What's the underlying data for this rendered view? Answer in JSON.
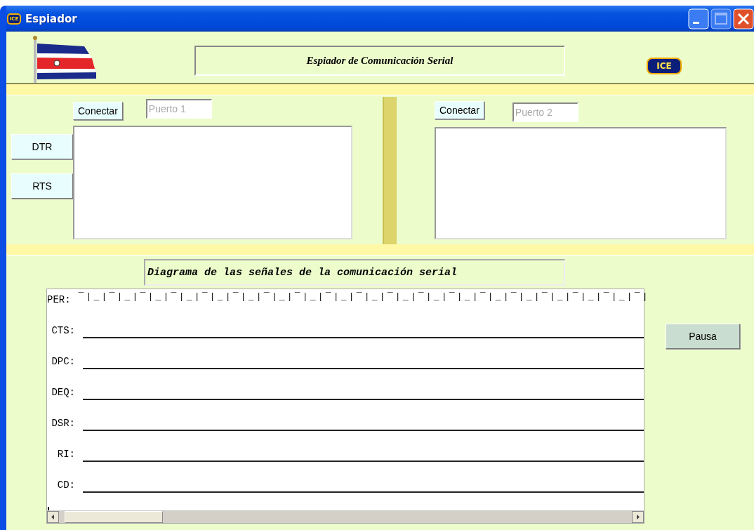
{
  "window": {
    "title": "Espiador",
    "icon_text": "ICE"
  },
  "header": {
    "title": "Espiador de Comunicación Serial",
    "logo_text": "ICE"
  },
  "ports": [
    {
      "connect_label": "Conectar",
      "port_placeholder": "Puerto 1"
    },
    {
      "connect_label": "Conectar",
      "port_placeholder": "Puerto 2"
    }
  ],
  "line_buttons": [
    "DTR",
    "RTS"
  ],
  "diagram": {
    "title": "Diagrama de las señales de la comunicación serial",
    "signals": [
      {
        "name": "PER:",
        "kind": "pulse",
        "trace": "¯|_|¯|_|¯|_|¯|_|¯|_|¯|_|¯|_|¯|_|¯|_|¯|_|¯|_|¯|_|¯|_|¯|_|¯|_|¯|_|¯|_|¯|_|¯|"
      },
      {
        "name": "CTS:",
        "kind": "low"
      },
      {
        "name": "DPC:",
        "kind": "low"
      },
      {
        "name": "DEQ:",
        "kind": "low"
      },
      {
        "name": "DSR:",
        "kind": "low"
      },
      {
        "name": "RI:",
        "kind": "low"
      },
      {
        "name": "CD:",
        "kind": "low"
      }
    ]
  },
  "pause_button": "Pausa"
}
